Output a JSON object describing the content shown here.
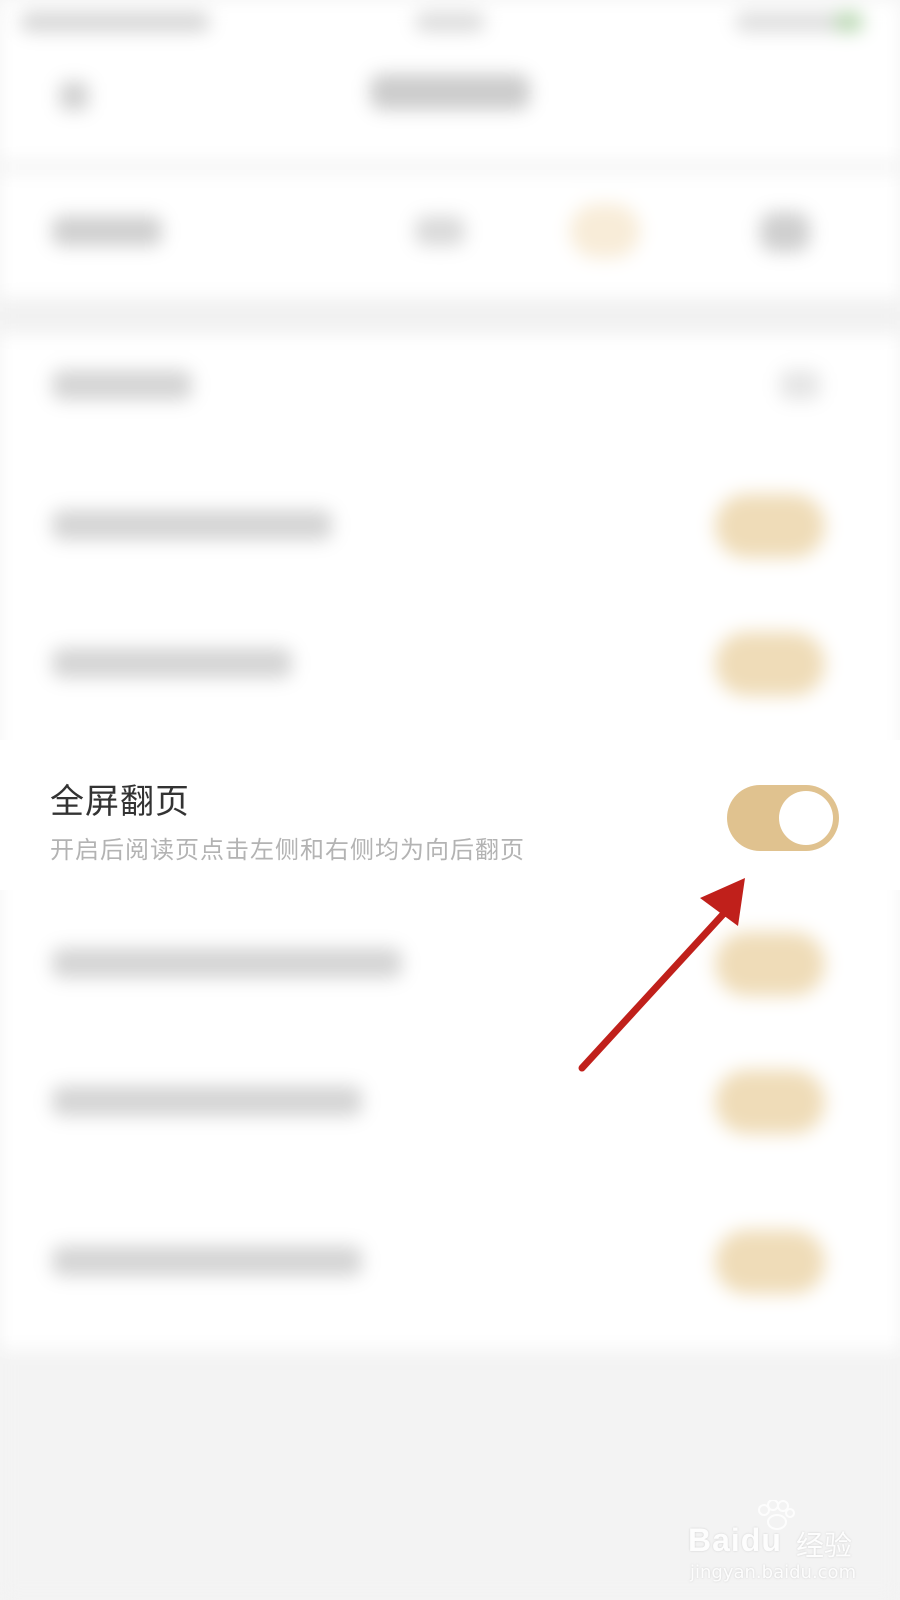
{
  "setting": {
    "title": "全屏翻页",
    "subtitle": "开启后阅读页点击左侧和右侧均为向后翻页",
    "enabled": true
  },
  "watermark": {
    "brand": "Bai",
    "brand_suffix": "du",
    "cn": "经验",
    "url": "jingyan.baidu.com"
  },
  "colors": {
    "toggle_on": "#e0c28f",
    "arrow": "#c0201b"
  }
}
